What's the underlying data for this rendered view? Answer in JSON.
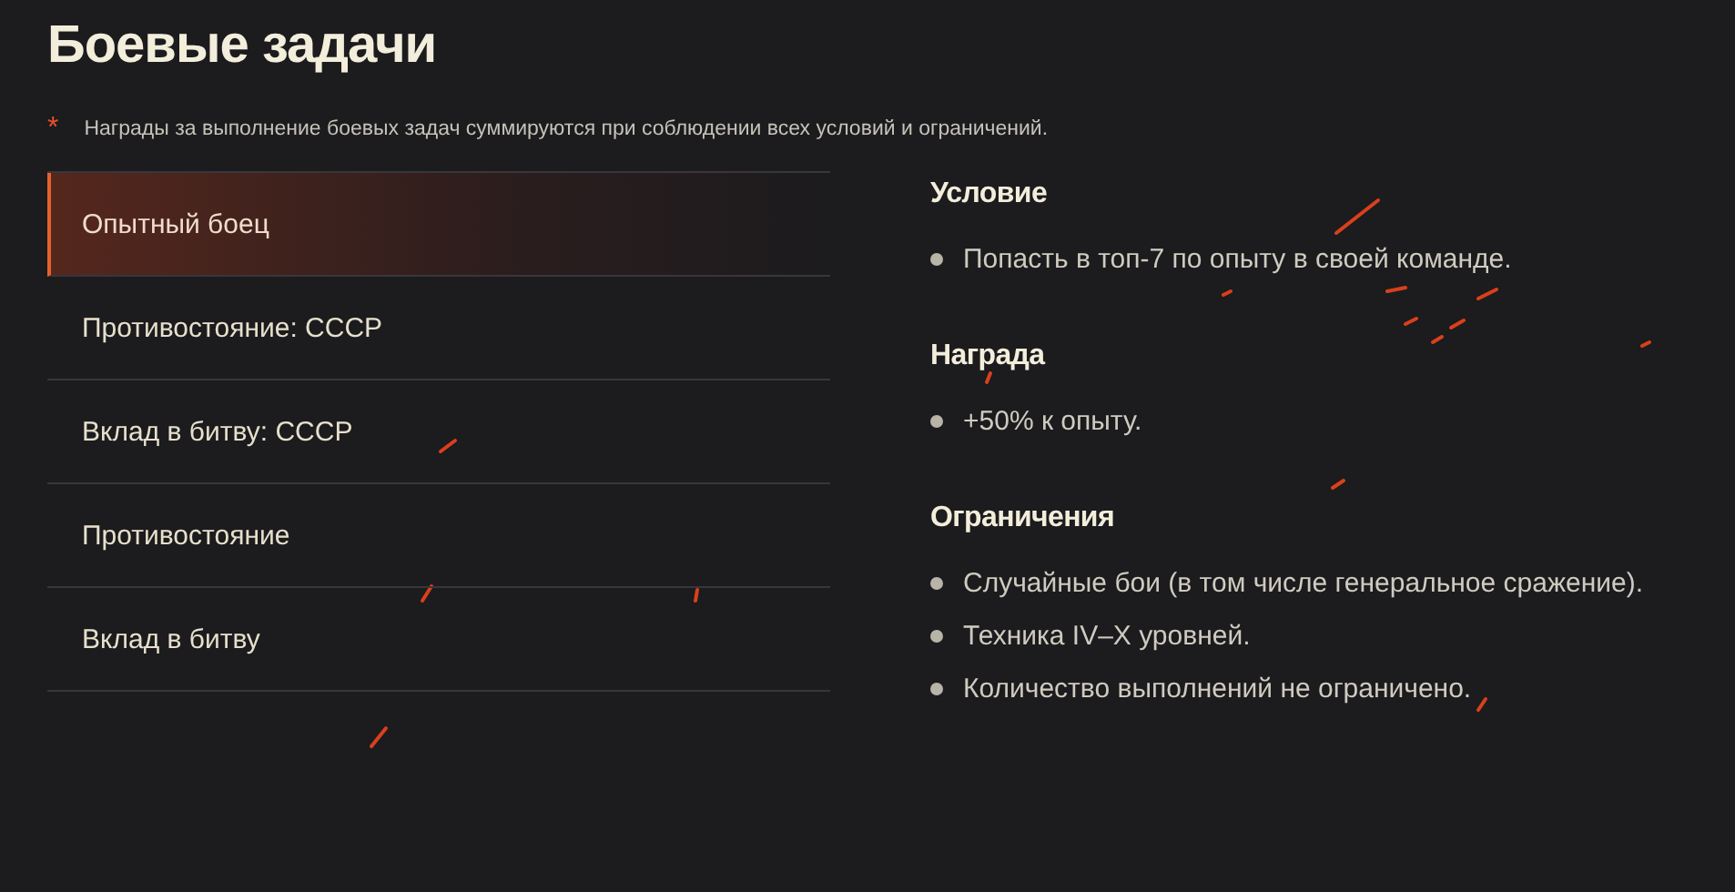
{
  "title": "Боевые задачи",
  "note": {
    "marker": "*",
    "text": "Награды за выполнение боевых задач суммируются при соблюдении всех условий и ограничений."
  },
  "tasks": [
    {
      "label": "Опытный боец",
      "selected": true
    },
    {
      "label": "Противостояние: СССР",
      "selected": false
    },
    {
      "label": "Вклад в битву: СССР",
      "selected": false
    },
    {
      "label": "Противостояние",
      "selected": false
    },
    {
      "label": "Вклад в битву",
      "selected": false
    }
  ],
  "sections": [
    {
      "heading": "Условие",
      "items": [
        "Попасть в топ-7 по опыту в своей команде."
      ]
    },
    {
      "heading": "Награда",
      "items": [
        "+50% к опыту."
      ]
    },
    {
      "heading": "Ограничения",
      "items": [
        "Случайные бои (в том числе генеральное сражение).",
        "Техника IV–X уровней.",
        "Количество выполнений не ограничено."
      ]
    }
  ]
}
